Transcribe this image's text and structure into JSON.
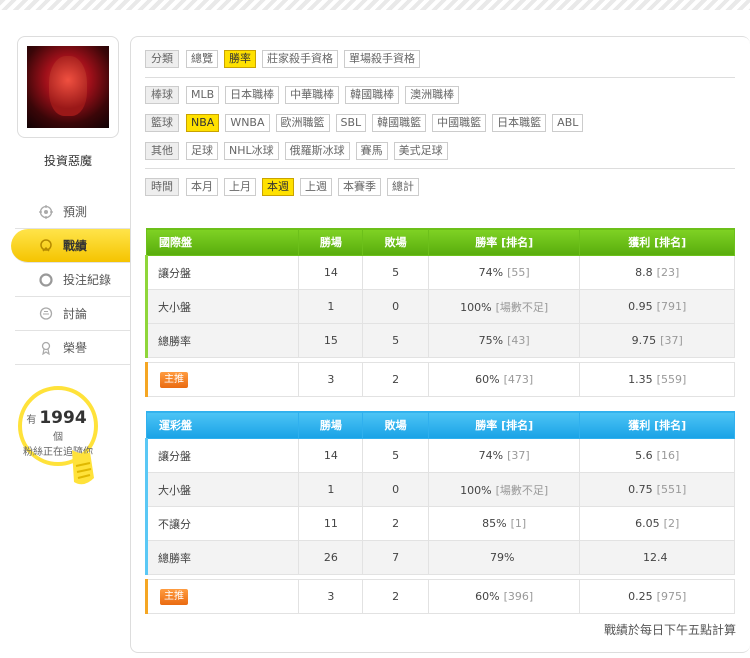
{
  "user": {
    "name": "投資惡魔"
  },
  "menu": [
    {
      "label": "預測",
      "icon": "target-icon",
      "active": false
    },
    {
      "label": "戰績",
      "icon": "record-icon",
      "active": true
    },
    {
      "label": "投注紀錄",
      "icon": "history-icon",
      "active": false
    },
    {
      "label": "討論",
      "icon": "chat-icon",
      "active": false
    },
    {
      "label": "榮譽",
      "icon": "trophy-icon",
      "active": false
    }
  ],
  "fans": {
    "prefix": "有",
    "count": "1994",
    "unit": "個",
    "suffix": "粉絲正在追隨你"
  },
  "filters": {
    "category": {
      "label": "分類",
      "items": [
        "總覽",
        "勝率",
        "莊家殺手資格",
        "單場殺手資格"
      ],
      "selected": "勝率"
    },
    "baseball": {
      "label": "棒球",
      "items": [
        "MLB",
        "日本職棒",
        "中華職棒",
        "韓國職棒",
        "澳洲職棒"
      ]
    },
    "basketball": {
      "label": "籃球",
      "items": [
        "NBA",
        "WNBA",
        "歐洲職籃",
        "SBL",
        "韓國職籃",
        "中國職籃",
        "日本職籃",
        "ABL"
      ],
      "selected": "NBA"
    },
    "other": {
      "label": "其他",
      "items": [
        "足球",
        "NHL冰球",
        "俄羅斯冰球",
        "賽馬",
        "美式足球"
      ]
    },
    "time": {
      "label": "時間",
      "items": [
        "本月",
        "上月",
        "本週",
        "上週",
        "本賽季",
        "總計"
      ],
      "selected": "本週"
    }
  },
  "table1": {
    "headers": [
      "國際盤",
      "勝場",
      "敗場",
      "勝率 [排名]",
      "獲利 [排名]"
    ],
    "rows": [
      {
        "name": "讓分盤",
        "win": "14",
        "lose": "5",
        "rate": "74%",
        "rate_rank": "[55]",
        "profit": "8.8",
        "profit_rank": "[23]"
      },
      {
        "name": "大小盤",
        "win": "1",
        "lose": "0",
        "rate": "100%",
        "rate_rank": "[場數不足]",
        "profit": "0.95",
        "profit_rank": "[791]"
      },
      {
        "name": "總勝率",
        "win": "15",
        "lose": "5",
        "rate": "75%",
        "rate_rank": "[43]",
        "profit": "9.75",
        "profit_rank": "[37]"
      }
    ],
    "main": {
      "badge": "主推",
      "win": "3",
      "lose": "2",
      "rate": "60%",
      "rate_rank": "[473]",
      "profit": "1.35",
      "profit_rank": "[559]"
    }
  },
  "table2": {
    "headers": [
      "運彩盤",
      "勝場",
      "敗場",
      "勝率 [排名]",
      "獲利 [排名]"
    ],
    "rows": [
      {
        "name": "讓分盤",
        "win": "14",
        "lose": "5",
        "rate": "74%",
        "rate_rank": "[37]",
        "profit": "5.6",
        "profit_rank": "[16]"
      },
      {
        "name": "大小盤",
        "win": "1",
        "lose": "0",
        "rate": "100%",
        "rate_rank": "[場數不足]",
        "profit": "0.75",
        "profit_rank": "[551]"
      },
      {
        "name": "不讓分",
        "win": "11",
        "lose": "2",
        "rate": "85%",
        "rate_rank": "[1]",
        "profit": "6.05",
        "profit_rank": "[2]"
      },
      {
        "name": "總勝率",
        "win": "26",
        "lose": "7",
        "rate": "79%",
        "rate_rank": "",
        "profit": "12.4",
        "profit_rank": ""
      }
    ],
    "main": {
      "badge": "主推",
      "win": "3",
      "lose": "2",
      "rate": "60%",
      "rate_rank": "[396]",
      "profit": "0.25",
      "profit_rank": "[975]"
    }
  },
  "note": "戰績於每日下午五點計算"
}
